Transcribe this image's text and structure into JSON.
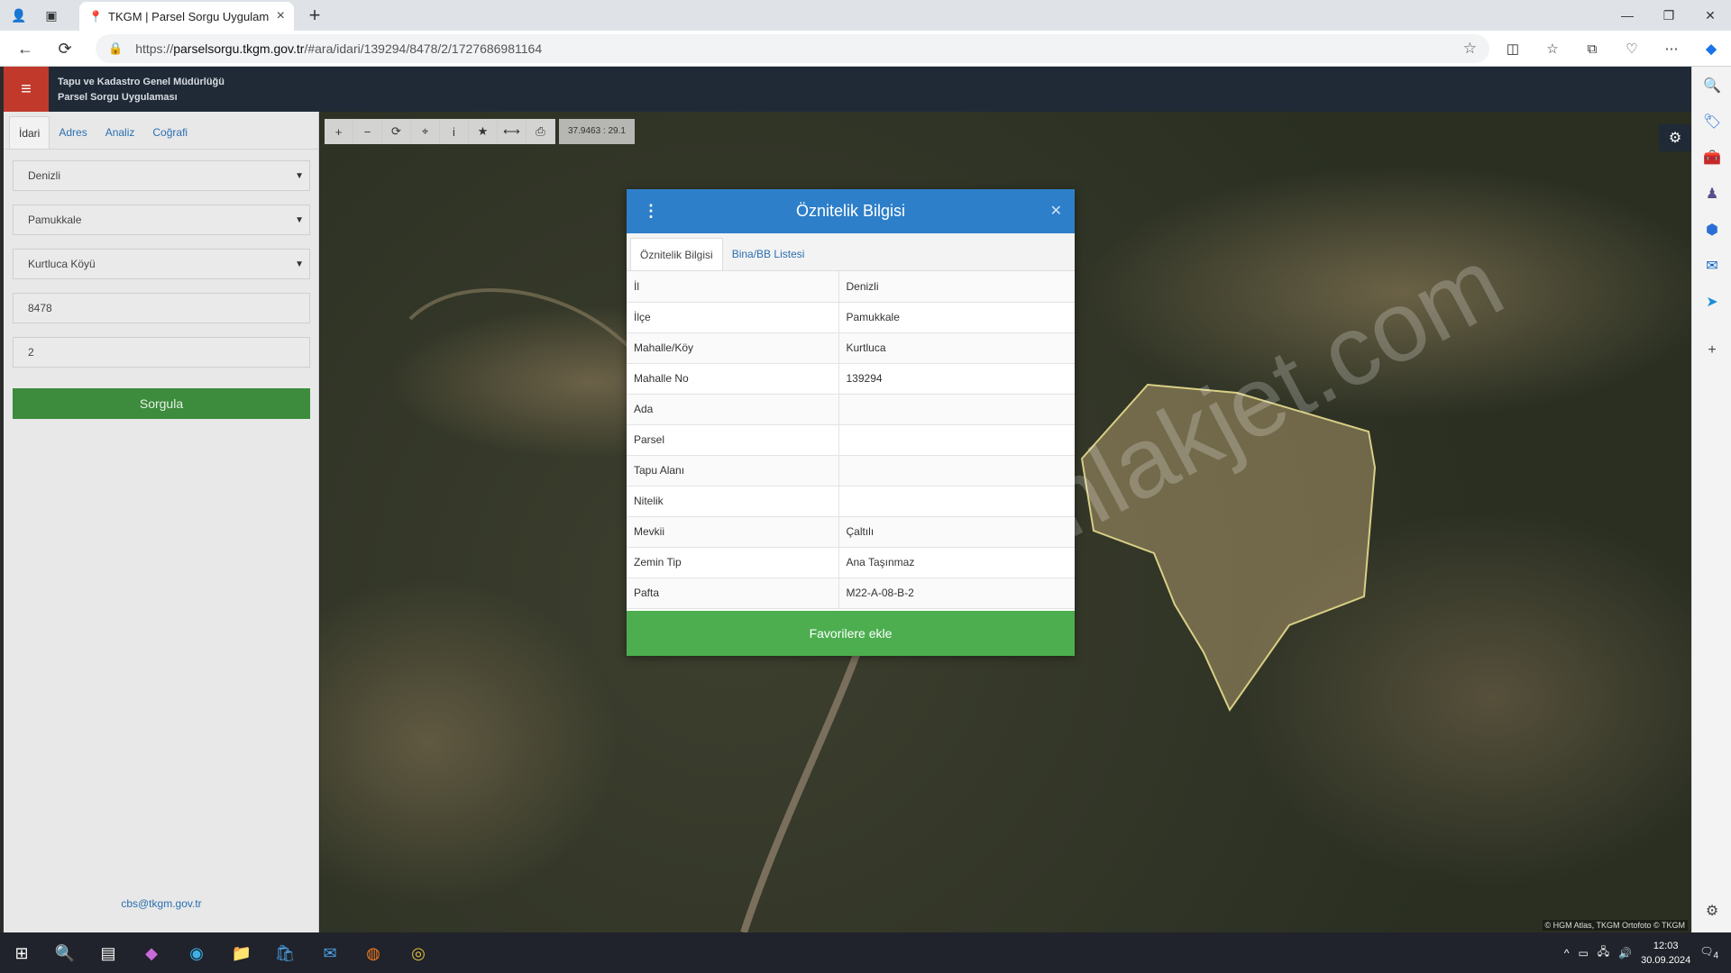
{
  "browser": {
    "tab_title": "TKGM | Parsel Sorgu Uygulaması",
    "url_scheme": "https://",
    "url_host": "parselsorgu.tkgm.gov.tr",
    "url_path": "/#ara/idari/139294/8478/2/1727686981164"
  },
  "app": {
    "title_line1": "Tapu ve Kadastro Genel Müdürlüğü",
    "title_line2": "Parsel Sorgu Uygulaması"
  },
  "left_panel": {
    "tabs": [
      "İdari",
      "Adres",
      "Analiz",
      "Coğrafi"
    ],
    "il": "Denizli",
    "ilce": "Pamukkale",
    "mahalle": "Kurtluca Köyü",
    "ada": "8478",
    "parsel": "2",
    "submit_label": "Sorgula",
    "footer_email": "cbs@tkgm.gov.tr"
  },
  "map": {
    "coordinates": "37.9463 : 29.1",
    "attribution": "© HGM Atlas, TKGM Ortofoto © TKGM",
    "watermark": "emlakjet.com"
  },
  "popup": {
    "title": "Öznitelik Bilgisi",
    "tabs": [
      "Öznitelik Bilgisi",
      "Bina/BB Listesi"
    ],
    "rows": [
      {
        "key": "İl",
        "value": "Denizli"
      },
      {
        "key": "İlçe",
        "value": "Pamukkale"
      },
      {
        "key": "Mahalle/Köy",
        "value": "Kurtluca"
      },
      {
        "key": "Mahalle No",
        "value": "139294"
      },
      {
        "key": "Ada",
        "value": ""
      },
      {
        "key": "Parsel",
        "value": ""
      },
      {
        "key": "Tapu Alanı",
        "value": ""
      },
      {
        "key": "Nitelik",
        "value": ""
      },
      {
        "key": "Mevkii",
        "value": "Çaltılı"
      },
      {
        "key": "Zemin Tip",
        "value": "Ana Taşınmaz"
      },
      {
        "key": "Pafta",
        "value": "M22-A-08-B-2"
      }
    ],
    "action_label": "Favorilere ekle"
  },
  "taskbar": {
    "time": "12:03",
    "date": "30.09.2024",
    "notification_count": "4"
  },
  "colors": {
    "header_bg": "#1f2a36",
    "menu_red": "#c0392b",
    "popup_blue": "#2e7fc9",
    "action_green": "#4cae4f",
    "submit_green": "#3d8b3d"
  }
}
